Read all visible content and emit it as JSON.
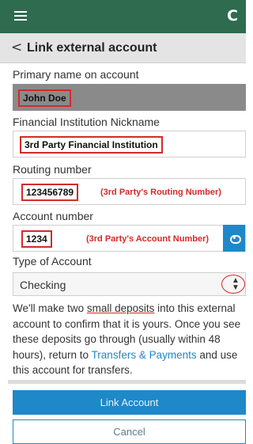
{
  "header": {
    "menu_icon": "hamburger-menu-icon",
    "refresh_icon": "refresh-icon",
    "refresh_glyph": "C"
  },
  "subheader": {
    "back_glyph": "<",
    "title": "Link external account"
  },
  "form": {
    "primary_name": {
      "label": "Primary name on account",
      "value": "John Doe"
    },
    "nickname": {
      "label": "Financial Institution Nickname",
      "value": "3rd Party Financial Institution"
    },
    "routing": {
      "label": "Routing number",
      "value": "123456789",
      "annotation": "(3rd Party's Routing Number)"
    },
    "account": {
      "label": "Account number",
      "value": "1234",
      "annotation": "(3rd Party's Account Number)",
      "toggle_icon": "eye-icon"
    },
    "account_type": {
      "label": "Type of Account",
      "selected": "Checking"
    }
  },
  "info": {
    "part1": "We'll make two ",
    "highlight": "small deposits",
    "part2": " into this external account to confirm that it is yours. Once you see these deposits go through (usually within 48 hours), return to ",
    "link": "Transfers & Payments",
    "part3": " and use this account for transfers."
  },
  "actions": {
    "link_label": "Link Account",
    "cancel_label": "Cancel"
  },
  "colors": {
    "header_bg": "#2e6b4f",
    "accent": "#1e88c9",
    "annotation_red": "#d42a2a"
  }
}
